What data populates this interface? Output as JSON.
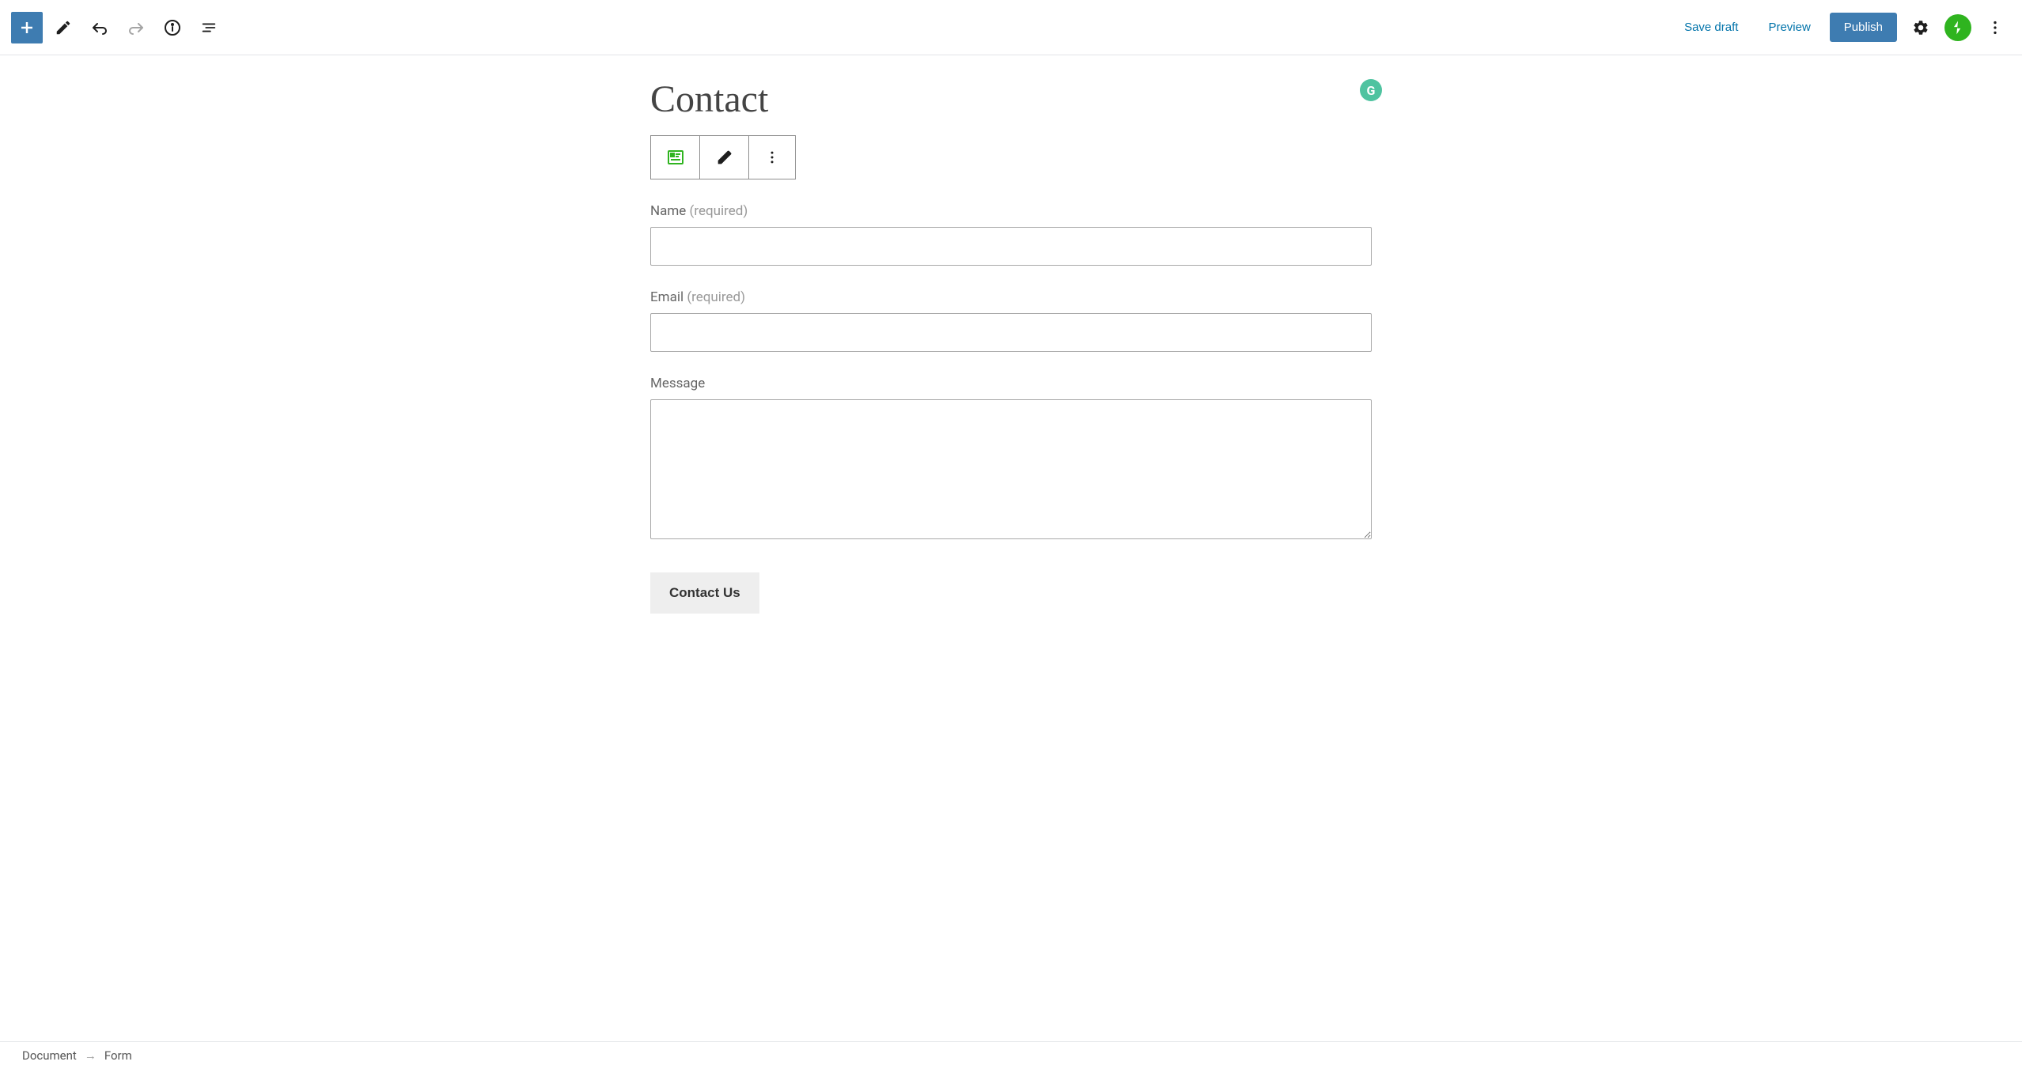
{
  "toolbar": {
    "save_draft": "Save draft",
    "preview": "Preview",
    "publish": "Publish"
  },
  "page": {
    "title": "Contact"
  },
  "form": {
    "fields": [
      {
        "label": "Name",
        "required_text": "(required)",
        "type": "text",
        "value": ""
      },
      {
        "label": "Email",
        "required_text": "(required)",
        "type": "email",
        "value": ""
      },
      {
        "label": "Message",
        "required_text": "",
        "type": "textarea",
        "value": ""
      }
    ],
    "submit_label": "Contact Us"
  },
  "breadcrumb": {
    "root": "Document",
    "current": "Form"
  },
  "grammarly": "G"
}
